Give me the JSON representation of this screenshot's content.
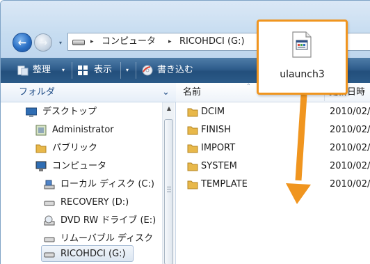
{
  "address": {
    "back_glyph": "←",
    "forward_glyph": "→",
    "history_caret": "▾",
    "breadcrumb": [
      {
        "label": "コンピュータ",
        "sep": "▸"
      },
      {
        "label": "RICOHDCI (G:)",
        "sep": "▸"
      }
    ]
  },
  "toolbar": {
    "organize_label": "整理",
    "views_label": "表示",
    "burn_label": "書き込む",
    "caret": "▾"
  },
  "navigation": {
    "header_label": "フォルダ",
    "header_chevron": "⌄",
    "items": [
      {
        "label": "デスクトップ",
        "icon": "desktop-icon"
      },
      {
        "label": "Administrator",
        "icon": "user-folder-icon"
      },
      {
        "label": "パブリック",
        "icon": "folder-icon"
      },
      {
        "label": "コンピュータ",
        "icon": "computer-icon"
      },
      {
        "label": "ローカル ディスク (C:)",
        "icon": "hard-drive-icon"
      },
      {
        "label": "RECOVERY (D:)",
        "icon": "drive-icon"
      },
      {
        "label": "DVD RW ドライブ (E:)",
        "icon": "dvd-drive-icon"
      },
      {
        "label": "リムーバブル ディスク",
        "icon": "removable-disk-icon"
      },
      {
        "label": "RICOHDCI (G:)",
        "icon": "drive-icon"
      }
    ],
    "selected_item": "RICOHDCI (G:)"
  },
  "file_list": {
    "columns": {
      "name": "名前",
      "date": "更新日時"
    },
    "sort_glyph": "⌃",
    "rows": [
      {
        "name": "DCIM",
        "date": "2010/02/"
      },
      {
        "name": "FINISH",
        "date": "2010/02/"
      },
      {
        "name": "IMPORT",
        "date": "2010/02/"
      },
      {
        "name": "SYSTEM",
        "date": "2010/02/"
      },
      {
        "name": "TEMPLATE",
        "date": "2010/02/"
      }
    ]
  },
  "callout": {
    "file_label": "ulaunch3",
    "icon": "application-file-icon",
    "border_color": "#f0951f",
    "arrow_color": "#f0951f"
  },
  "colors": {
    "toolbar": "#2f5d8c",
    "nav_header_text": "#1e4c86",
    "folder": "#e8b84a"
  }
}
